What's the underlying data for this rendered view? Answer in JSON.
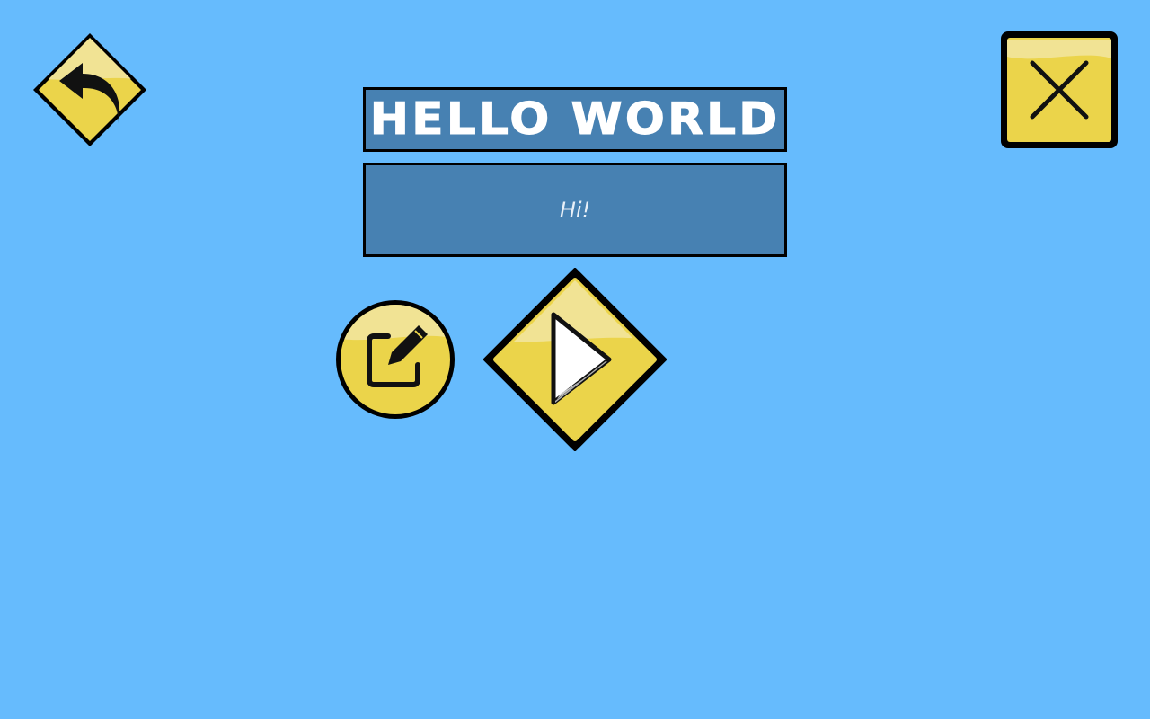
{
  "title": "HELLO WORLD",
  "message": "Hi!",
  "buttons": {
    "back": {
      "icon": "undo-arrow-icon"
    },
    "close": {
      "icon": "close-x-icon"
    },
    "edit": {
      "icon": "edit-pencil-icon"
    },
    "play": {
      "icon": "play-triangle-icon"
    }
  },
  "colors": {
    "background": "#66bbfd",
    "panel": "#4781b2",
    "button_yellow": "#ebd44a",
    "button_highlight": "#f1e394",
    "outline": "#000000",
    "title_text": "#ffffff"
  }
}
